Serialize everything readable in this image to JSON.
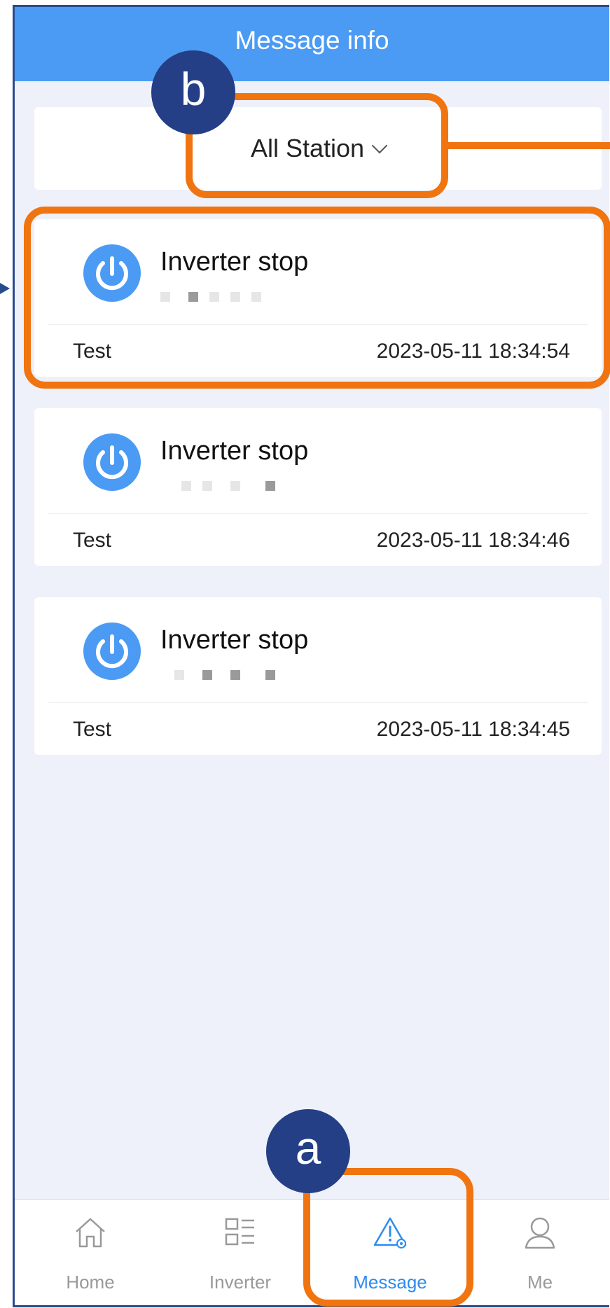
{
  "header": {
    "title": "Message info"
  },
  "station_selector": {
    "label": "All Station"
  },
  "messages": [
    {
      "title": "Inverter stop",
      "station": "Test",
      "time": "2023-05-11 18:34:54"
    },
    {
      "title": "Inverter stop",
      "station": "Test",
      "time": "2023-05-11 18:34:46"
    },
    {
      "title": "Inverter stop",
      "station": "Test",
      "time": "2023-05-11 18:34:45"
    }
  ],
  "tabs": [
    {
      "label": "Home",
      "icon": "home-icon",
      "active": false
    },
    {
      "label": "Inverter",
      "icon": "list-icon",
      "active": false
    },
    {
      "label": "Message",
      "icon": "alert-triangle-icon",
      "active": true
    },
    {
      "label": "Me",
      "icon": "user-icon",
      "active": false
    }
  ],
  "annotations": {
    "badge_a": "a",
    "badge_b": "b"
  },
  "colors": {
    "header": "#4b9bf4",
    "highlight": "#f07410",
    "badge": "#243f86",
    "active_tab": "#2d8cf0"
  }
}
